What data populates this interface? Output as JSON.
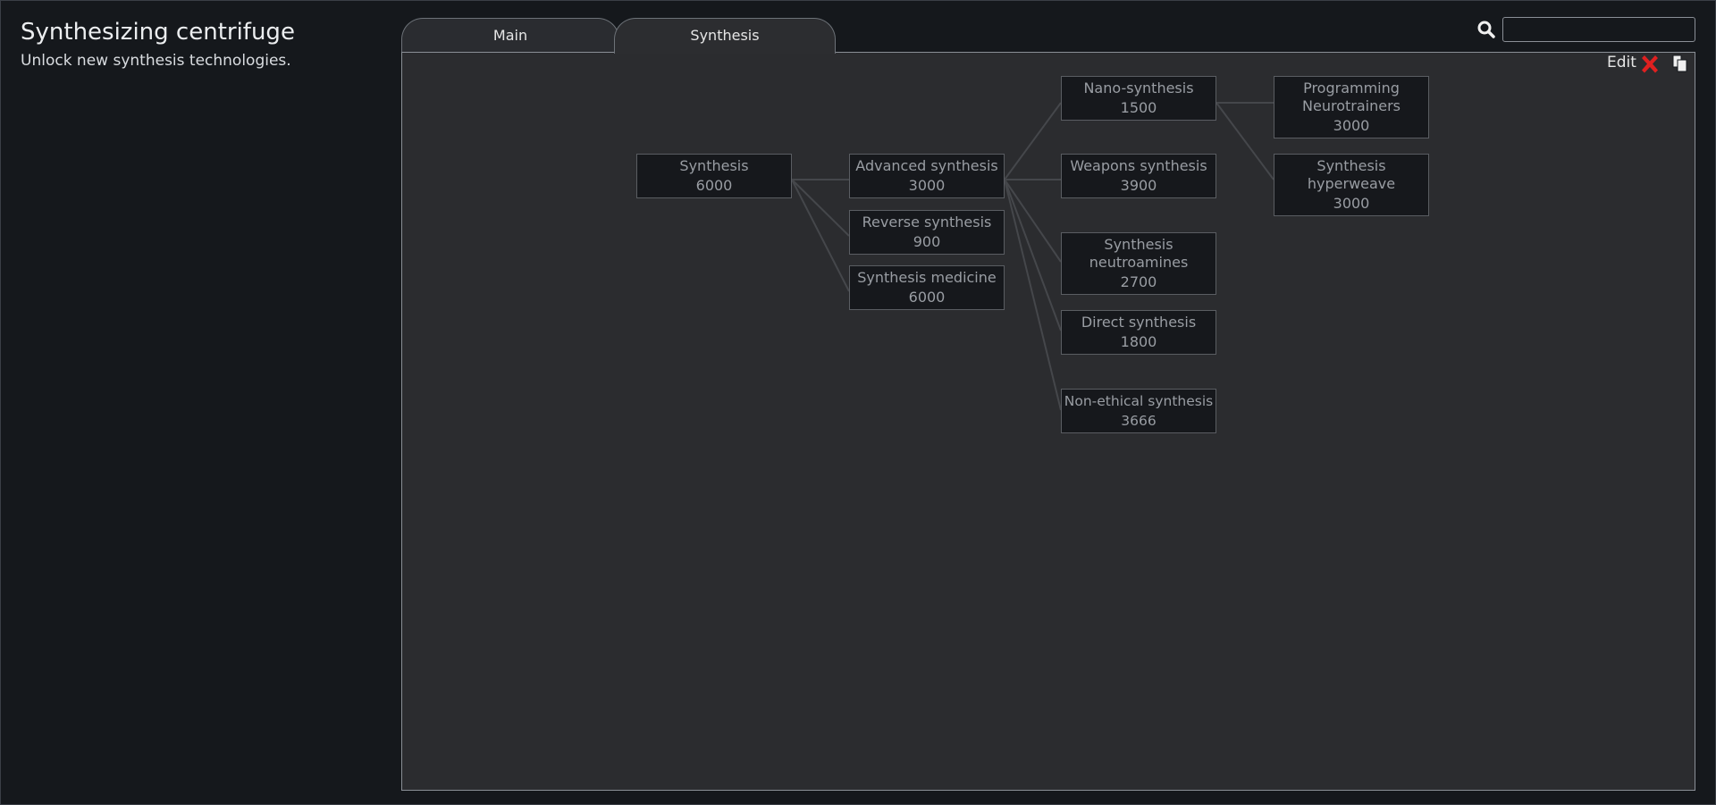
{
  "header": {
    "title": "Synthesizing centrifuge",
    "subtitle": "Unlock new synthesis technologies."
  },
  "tabs": [
    {
      "label": "Main",
      "active": false
    },
    {
      "label": "Synthesis",
      "active": true
    }
  ],
  "search": {
    "value": "",
    "placeholder": ""
  },
  "toolbar": {
    "edit_label": "Edit",
    "close_icon": "red-x-icon",
    "copy_icon": "copy-icon"
  },
  "tree": {
    "nodes": [
      {
        "name": "Synthesis",
        "cost": "6000"
      },
      {
        "name": "Advanced synthesis",
        "cost": "3000"
      },
      {
        "name": "Reverse synthesis",
        "cost": "900"
      },
      {
        "name": "Synthesis medicine",
        "cost": "6000"
      },
      {
        "name": "Nano-synthesis",
        "cost": "1500"
      },
      {
        "name": "Weapons synthesis",
        "cost": "3900"
      },
      {
        "name": "Synthesis neutroamines",
        "cost": "2700"
      },
      {
        "name": "Direct synthesis",
        "cost": "1800"
      },
      {
        "name": "Non-ethical synthesis",
        "cost": "3666"
      },
      {
        "name": "Programming Neurotrainers",
        "cost": "3000"
      },
      {
        "name": "Synthesis hyperweave",
        "cost": "3000"
      }
    ]
  },
  "colors": {
    "background": "#15181c",
    "panel": "#2b2c2f",
    "node_bg": "#16181c",
    "node_text": "#999da3",
    "close_red": "#e02020"
  }
}
